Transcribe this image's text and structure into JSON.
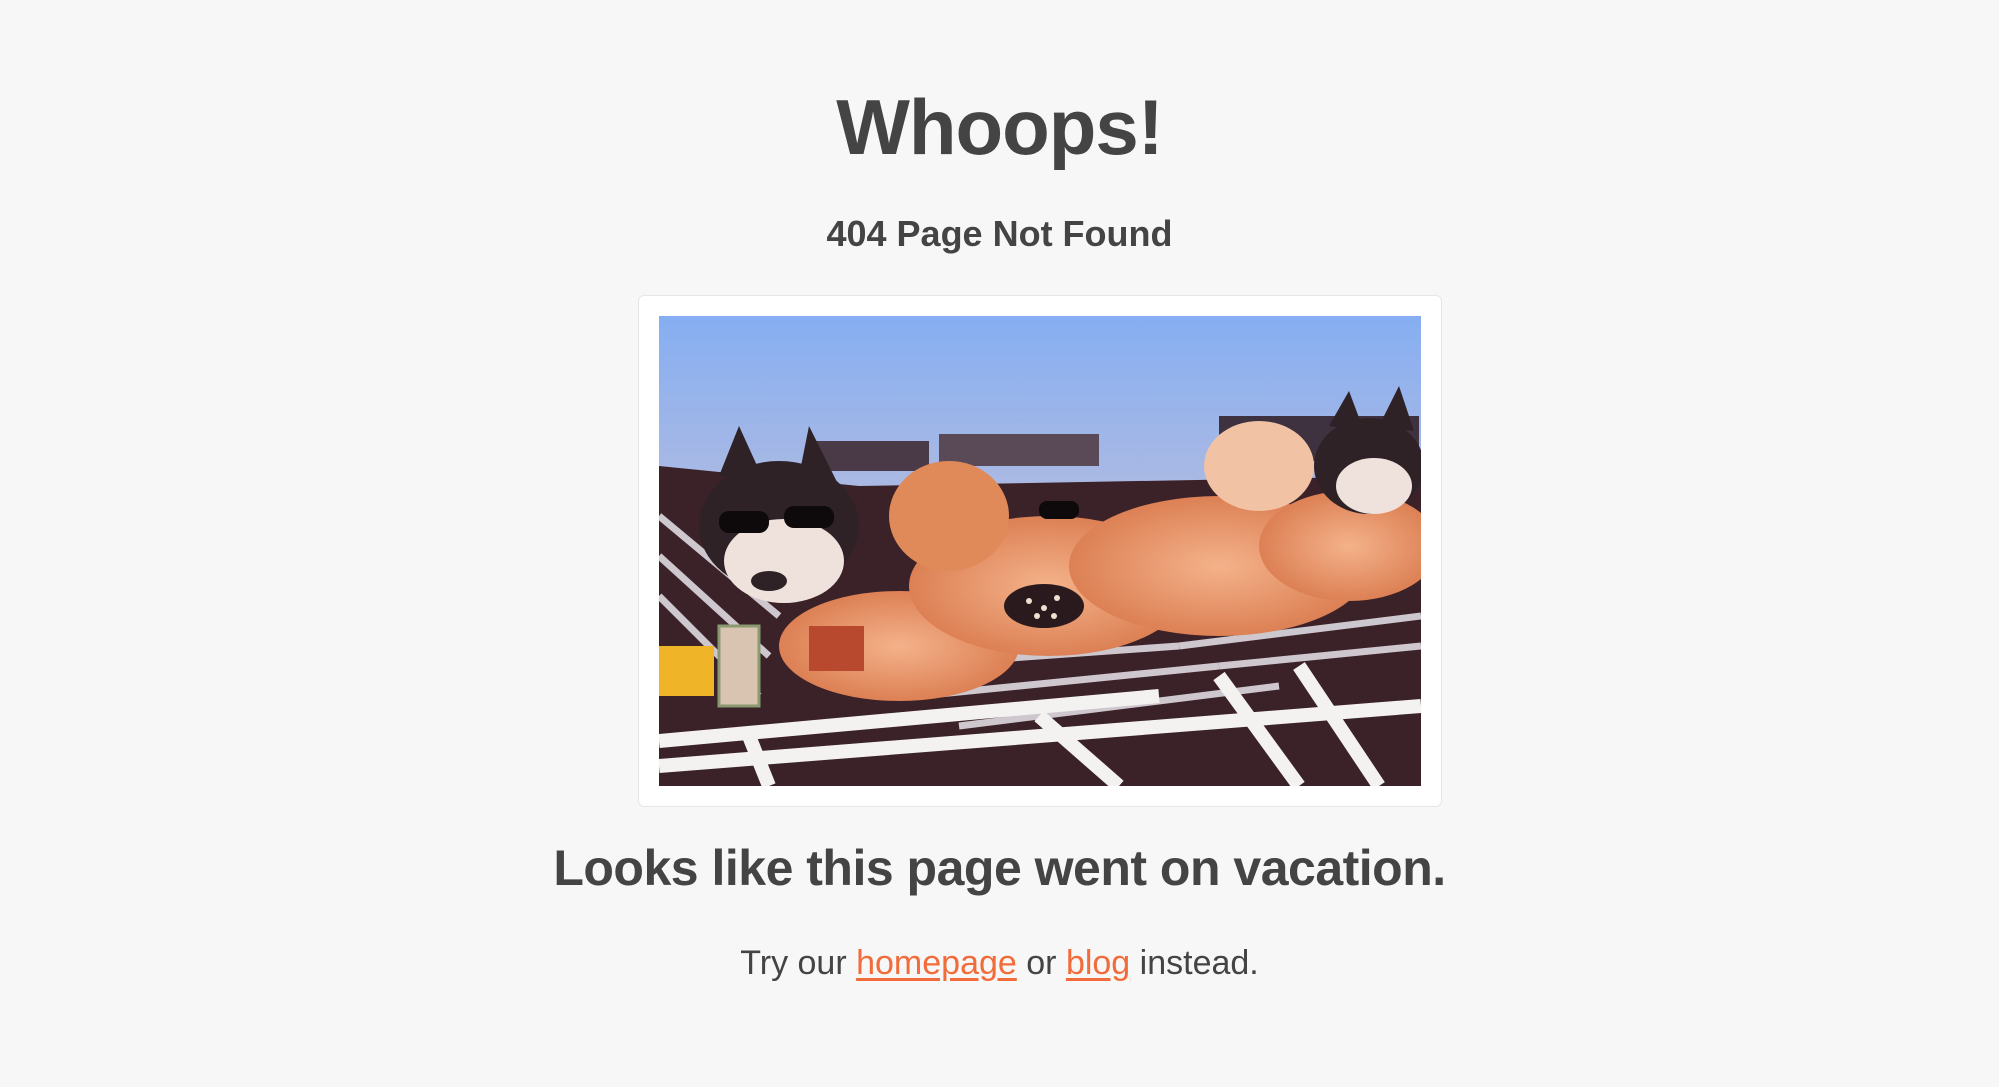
{
  "error": {
    "title": "Whoops!",
    "subtitle": "404 Page Not Found",
    "tagline": "Looks like this page went on vacation.",
    "suggestion": {
      "prefix": "Try our",
      "homepage_link": "homepage",
      "middle": "or",
      "blog_link": "blog",
      "suffix": "instead."
    }
  },
  "colors": {
    "background": "#f7f7f7",
    "text": "#444444",
    "link": "#f26b3a",
    "frame": "#ffffff"
  },
  "image": {
    "subject": "husky-dogs-sunbathing-on-loungers-photo"
  }
}
